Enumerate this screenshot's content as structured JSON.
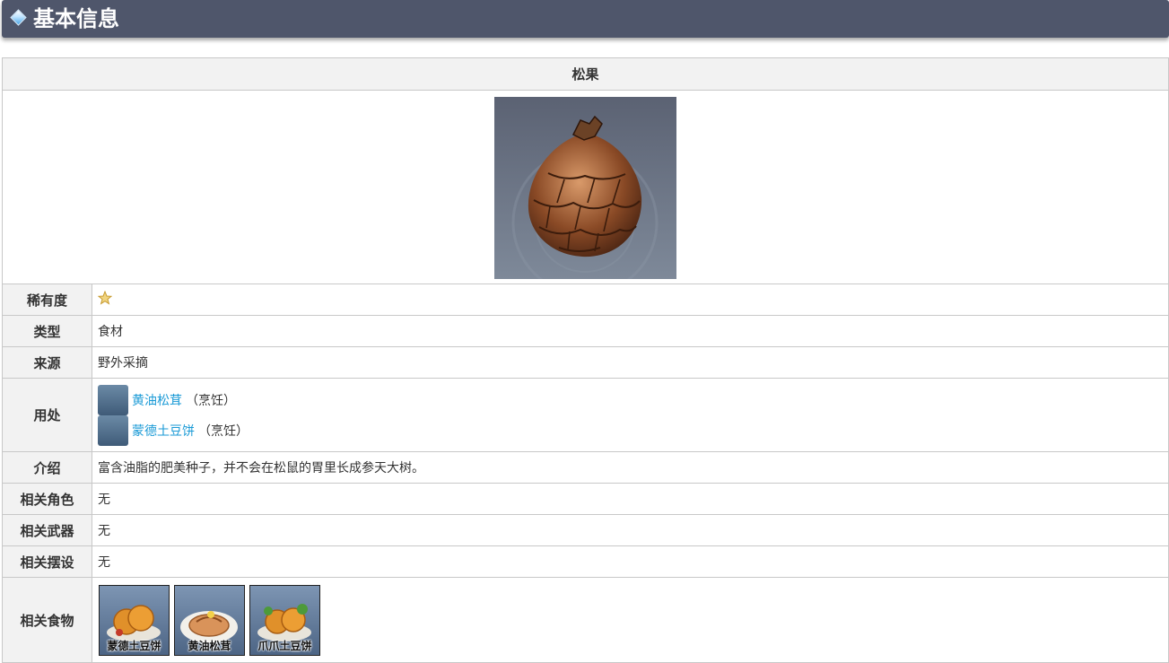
{
  "header": {
    "title": "基本信息"
  },
  "item": {
    "name": "松果"
  },
  "rows": {
    "rarity": {
      "label": "稀有度",
      "stars": 1
    },
    "type": {
      "label": "类型",
      "value": "食材"
    },
    "source": {
      "label": "来源",
      "value": "野外采摘"
    },
    "usage": {
      "label": "用处",
      "items": [
        {
          "name": "黄油松茸",
          "note": "（烹饪）"
        },
        {
          "name": "蒙德土豆饼",
          "note": "（烹饪）"
        }
      ]
    },
    "intro": {
      "label": "介绍",
      "value": "富含油脂的肥美种子，并不会在松鼠的胃里长成参天大树。"
    },
    "related_character": {
      "label": "相关角色",
      "value": "无"
    },
    "related_weapon": {
      "label": "相关武器",
      "value": "无"
    },
    "related_furnishing": {
      "label": "相关摆设",
      "value": "无"
    },
    "related_food": {
      "label": "相关食物",
      "items": [
        {
          "name": "蒙德土豆饼"
        },
        {
          "name": "黄油松茸"
        },
        {
          "name": "爪爪土豆饼"
        }
      ]
    }
  },
  "colors": {
    "header_bg": "#4f566b",
    "link": "#1a9ad6",
    "label_bg": "#f2f2f2",
    "star": "#e8c35a"
  }
}
